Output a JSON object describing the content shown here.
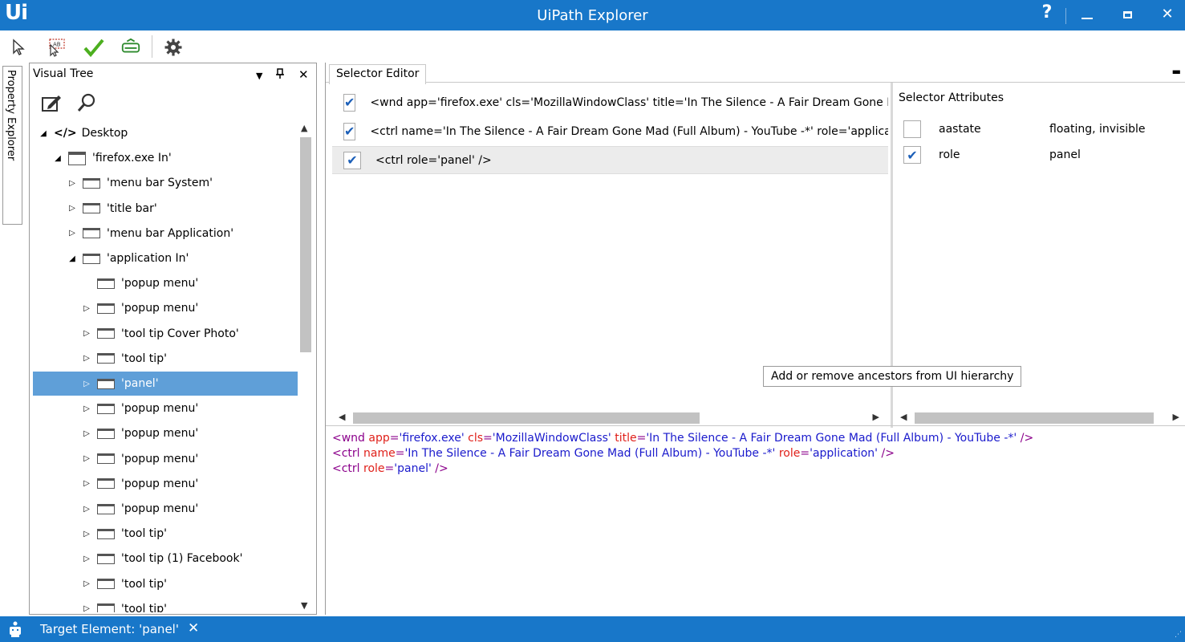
{
  "window": {
    "logo": "Ui",
    "title": "UiPath Explorer",
    "help": "?",
    "close": "✕"
  },
  "property_explorer": {
    "label": "Property Explorer"
  },
  "visual_tree": {
    "title": "Visual Tree",
    "dropdown": "▼",
    "pin": "📌",
    "close": "✕",
    "nodes": [
      {
        "label": "Desktop",
        "expander": "◢",
        "icon": "code-icon"
      },
      {
        "label": "'firefox.exe In'",
        "expander": "◢",
        "icon": "window-icon"
      },
      {
        "label": "'menu bar  System'",
        "expander": "▷",
        "icon": "element-icon"
      },
      {
        "label": "'title bar'",
        "expander": "▷",
        "icon": "element-icon"
      },
      {
        "label": "'menu bar  Application'",
        "expander": "▷",
        "icon": "element-icon"
      },
      {
        "label": "'application In'",
        "expander": "◢",
        "icon": "element-icon"
      },
      {
        "label": "'popup menu'",
        "expander": "",
        "icon": "element-icon"
      },
      {
        "label": "'popup menu'",
        "expander": "▷",
        "icon": "element-icon"
      },
      {
        "label": "'tool tip  Cover Photo'",
        "expander": "▷",
        "icon": "element-icon"
      },
      {
        "label": "'tool tip'",
        "expander": "▷",
        "icon": "element-icon"
      },
      {
        "label": "'panel'",
        "expander": "▷",
        "icon": "element-icon"
      },
      {
        "label": "'popup menu'",
        "expander": "▷",
        "icon": "element-icon"
      },
      {
        "label": "'popup menu'",
        "expander": "▷",
        "icon": "element-icon"
      },
      {
        "label": "'popup menu'",
        "expander": "▷",
        "icon": "element-icon"
      },
      {
        "label": "'popup menu'",
        "expander": "▷",
        "icon": "element-icon"
      },
      {
        "label": "'popup menu'",
        "expander": "▷",
        "icon": "element-icon"
      },
      {
        "label": "'tool tip'",
        "expander": "▷",
        "icon": "element-icon"
      },
      {
        "label": "'tool tip  (1) Facebook'",
        "expander": "▷",
        "icon": "element-icon"
      },
      {
        "label": "'tool tip'",
        "expander": "▷",
        "icon": "element-icon"
      },
      {
        "label": "'tool tip'",
        "expander": "▷",
        "icon": "element-icon"
      }
    ],
    "selected_index": 10
  },
  "selector_editor": {
    "tab_label": "Selector Editor",
    "menu": "▬",
    "rows": [
      {
        "checked": true,
        "text": "<wnd app='firefox.exe' cls='MozillaWindowClass' title='In The Silence - A Fair Dream Gone Mad (Full Album) - YouTube -*' />"
      },
      {
        "checked": true,
        "text": "<ctrl name='In The Silence - A Fair Dream Gone Mad (Full Album) - YouTube -*' role='application' />"
      },
      {
        "checked": true,
        "text": "<ctrl role='panel' />"
      }
    ],
    "active_row": 2
  },
  "selector_attributes": {
    "title": "Selector Attributes",
    "items": [
      {
        "checked": false,
        "name": "aastate",
        "value": "floating, invisible"
      },
      {
        "checked": true,
        "name": "role",
        "value": "panel"
      }
    ]
  },
  "tooltip": "Add or remove ancestors from UI hierarchy",
  "selector_output": {
    "lines": [
      [
        {
          "t": "tag",
          "v": "<wnd "
        },
        {
          "t": "attr",
          "v": "app"
        },
        {
          "t": "tag",
          "v": "="
        },
        {
          "t": "val",
          "v": "'firefox.exe'"
        },
        {
          "t": "attr",
          "v": " cls"
        },
        {
          "t": "tag",
          "v": "="
        },
        {
          "t": "val",
          "v": "'MozillaWindowClass'"
        },
        {
          "t": "attr",
          "v": " title"
        },
        {
          "t": "tag",
          "v": "="
        },
        {
          "t": "val",
          "v": "'In The Silence - A Fair Dream Gone Mad (Full Album) - YouTube -*'"
        },
        {
          "t": "tag",
          "v": " />"
        }
      ],
      [
        {
          "t": "tag",
          "v": "<ctrl "
        },
        {
          "t": "attr",
          "v": "name"
        },
        {
          "t": "tag",
          "v": "="
        },
        {
          "t": "val",
          "v": "'In The Silence - A Fair Dream Gone Mad (Full Album) - YouTube -*'"
        },
        {
          "t": "attr",
          "v": " role"
        },
        {
          "t": "tag",
          "v": "="
        },
        {
          "t": "val",
          "v": "'application'"
        },
        {
          "t": "tag",
          "v": " />"
        }
      ],
      [
        {
          "t": "tag",
          "v": "<ctrl "
        },
        {
          "t": "attr",
          "v": "role"
        },
        {
          "t": "tag",
          "v": "="
        },
        {
          "t": "val",
          "v": "'panel'"
        },
        {
          "t": "tag",
          "v": " />"
        }
      ]
    ]
  },
  "status": {
    "text": "Target Element: 'panel'",
    "close": "✕"
  },
  "colors": {
    "brand": "#1877c9",
    "selection": "#5f9fd8",
    "tag": "#8b008b",
    "attr": "#e0201a",
    "value": "#1a1acc",
    "check": "#1c5fb8"
  }
}
